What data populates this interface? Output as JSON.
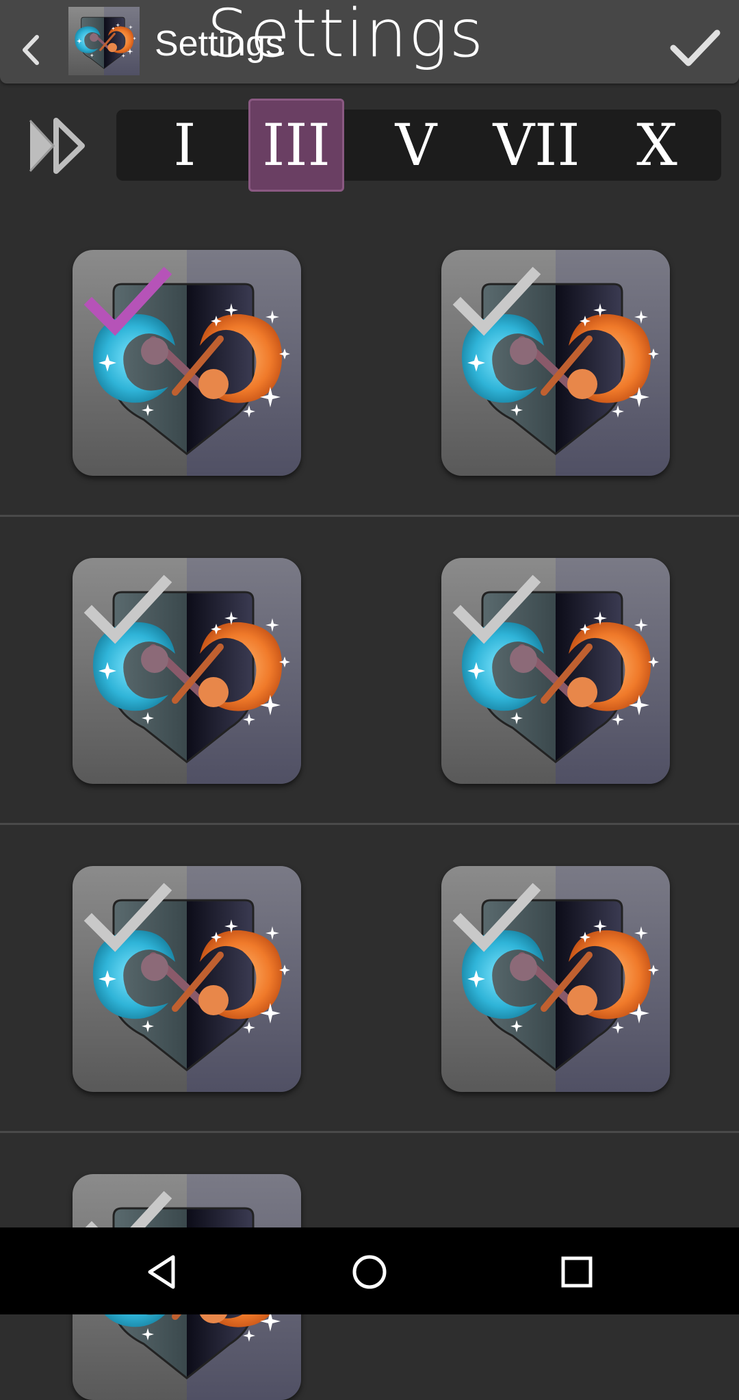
{
  "header": {
    "title_small": "Settings",
    "title_large": "Settings",
    "app_icon": "app-logo",
    "back_icon": "chevron-left-icon",
    "confirm_icon": "checkmark-icon"
  },
  "levels": {
    "skip_icon": "fast-forward-icon",
    "tabs": [
      {
        "label": "I",
        "active": false
      },
      {
        "label": "III",
        "active": true
      },
      {
        "label": "V",
        "active": false
      },
      {
        "label": "VII",
        "active": false
      },
      {
        "label": "X",
        "active": false
      }
    ]
  },
  "grid": {
    "item_icon": "heart-palette-icon",
    "check_icon": "checkmark-icon",
    "items": [
      {
        "selected": true
      },
      {
        "selected": false
      },
      {
        "selected": false
      },
      {
        "selected": false
      },
      {
        "selected": false
      },
      {
        "selected": false
      },
      {
        "selected": false
      }
    ]
  },
  "navbar": {
    "back_icon": "nav-back-icon",
    "home_icon": "nav-home-icon",
    "recents_icon": "nav-recents-icon"
  },
  "colors": {
    "background": "#2e2e2e",
    "appbar": "#474747",
    "accent": "#b653b8",
    "active_tab": "#6a3f63",
    "unselected_check": "#c9c9c9"
  }
}
